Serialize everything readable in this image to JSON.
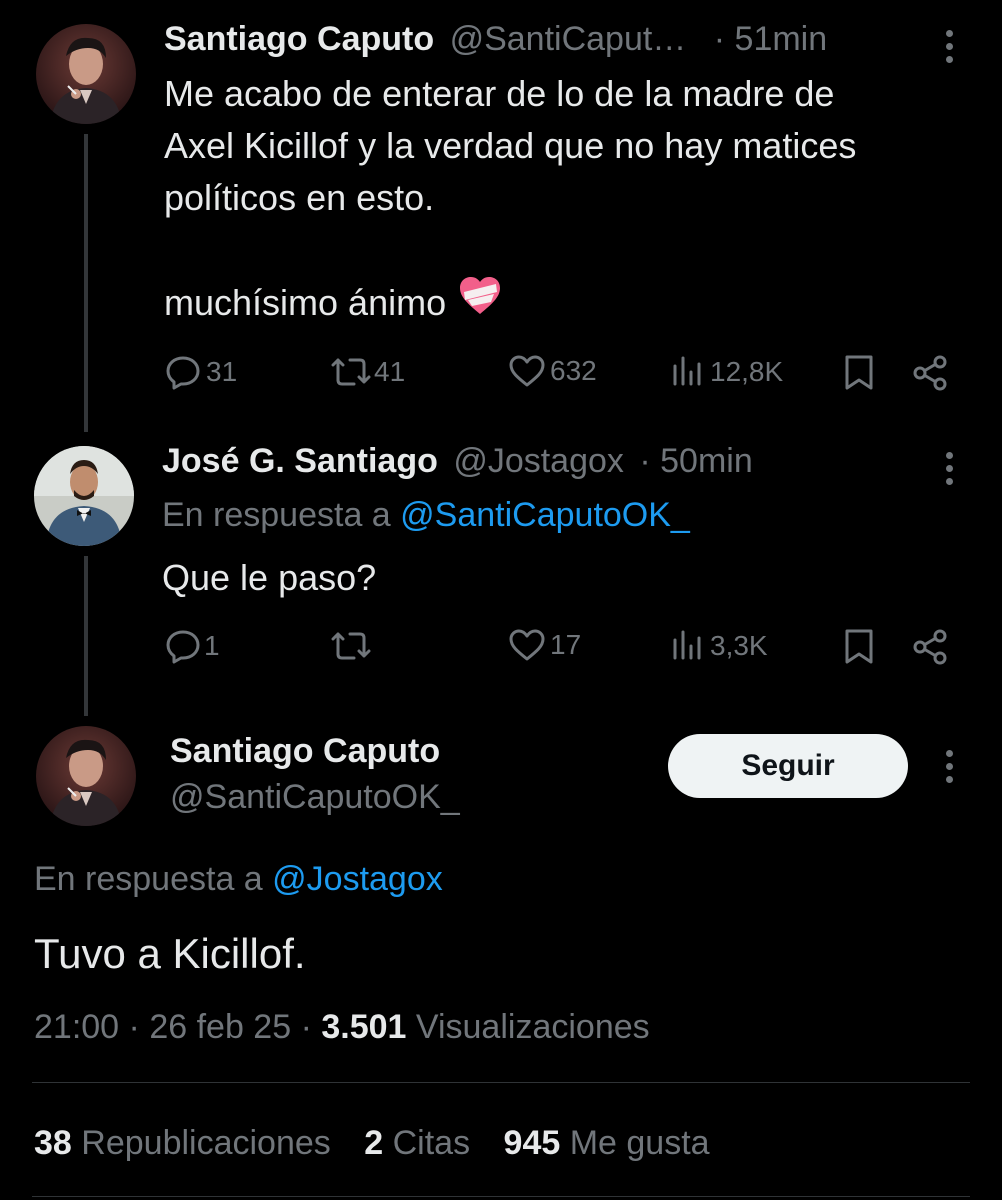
{
  "tweet1": {
    "name": "Santiago Caputo",
    "handle": "@SantiCaput…",
    "time": "· 51min",
    "text_lines": [
      "Me acabo de enterar de lo de la madre de",
      "Axel Kicillof y la verdad que no hay matices",
      "políticos en esto."
    ],
    "text_line2": "muchísimo ánimo",
    "emoji": "mending-heart",
    "replies": "31",
    "retweets": "41",
    "likes": "632",
    "views": "12,8K"
  },
  "tweet2": {
    "name": "José G. Santiago",
    "handle": "@Jostagox",
    "time": "· 50min",
    "reply_prefix": "En respuesta a",
    "reply_to": "@SantiCaputoOK_",
    "text": "Que le paso?",
    "replies": "1",
    "retweets": "",
    "likes": "17",
    "views": "3,3K"
  },
  "main_tweet": {
    "name": "Santiago Caputo",
    "handle": "@SantiCaputoOK_",
    "follow_label": "Seguir",
    "reply_prefix": "En respuesta a",
    "reply_to": "@Jostagox",
    "text": "Tuvo a Kicillof.",
    "time": "21:00",
    "sep1": "·",
    "date": "26 feb 25",
    "sep2": "·",
    "views_count": "3.501",
    "views_label": "Visualizaciones",
    "reposts_count": "38",
    "reposts_label": "Republicaciones",
    "quotes_count": "2",
    "quotes_label": "Citas",
    "likes_count": "945",
    "likes_label": "Me gusta"
  },
  "colors": {
    "background": "#000000",
    "text": "#e7e9ea",
    "muted": "#71767b",
    "link": "#1d9bf0"
  }
}
